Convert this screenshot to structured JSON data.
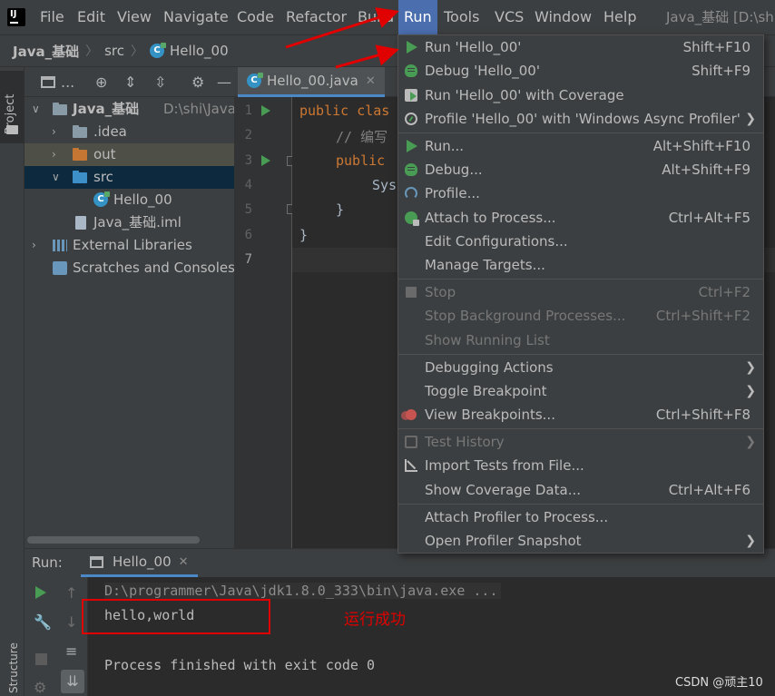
{
  "menubar": {
    "items": [
      "File",
      "Edit",
      "View",
      "Navigate",
      "Code",
      "Refactor",
      "Build",
      "Run",
      "Tools",
      "VCS",
      "Window",
      "Help"
    ],
    "active": "Run",
    "window_title": "Java_基础 [D:\\shi"
  },
  "navbar": {
    "crumbs": [
      "Java_基础",
      "src",
      "Hello_00"
    ]
  },
  "left_stripe": {
    "project_label": "Project",
    "structure_label": "Structure"
  },
  "project_panel": {
    "toolbar_dropdown": "...",
    "tree": [
      {
        "label": "Java_基础",
        "path": "D:\\shi\\Java\\te"
      },
      {
        "label": ".idea"
      },
      {
        "label": "out"
      },
      {
        "label": "src"
      },
      {
        "label": "Hello_00"
      },
      {
        "label": "Java_基础.iml"
      },
      {
        "label": "External Libraries"
      },
      {
        "label": "Scratches and Consoles"
      }
    ]
  },
  "editor": {
    "tab_label": "Hello_00.java",
    "line_numbers": [
      "1",
      "2",
      "3",
      "4",
      "5",
      "6",
      "7"
    ],
    "code": {
      "line1_kw": "public clas",
      "line2_comment": "// 编写",
      "line3_kw": "public",
      "line4": "Sys",
      "line5": "}",
      "line6": "}"
    }
  },
  "run_menu": {
    "items": [
      {
        "label": "Run 'Hello_00'",
        "shortcut": "Shift+F10",
        "icon": "run-icon"
      },
      {
        "label": "Debug 'Hello_00'",
        "shortcut": "Shift+F9",
        "icon": "debug-icon"
      },
      {
        "label": "Run 'Hello_00' with Coverage",
        "shortcut": "",
        "icon": "coverage-icon"
      },
      {
        "label": "Profile 'Hello_00' with 'Windows Async Profiler'",
        "shortcut": "",
        "icon": "profile-icon",
        "submenu": true
      },
      {
        "label": "Run...",
        "shortcut": "Alt+Shift+F10",
        "icon": "run-icon"
      },
      {
        "label": "Debug...",
        "shortcut": "Alt+Shift+F9",
        "icon": "debug-icon"
      },
      {
        "label": "Profile...",
        "shortcut": "",
        "icon": "gauge-icon"
      },
      {
        "label": "Attach to Process...",
        "shortcut": "Ctrl+Alt+F5",
        "icon": "attach-icon"
      },
      {
        "label": "Edit Configurations...",
        "shortcut": ""
      },
      {
        "label": "Manage Targets...",
        "shortcut": ""
      },
      {
        "label": "Stop",
        "shortcut": "Ctrl+F2",
        "icon": "stop-icon",
        "disabled": true
      },
      {
        "label": "Stop Background Processes...",
        "shortcut": "Ctrl+Shift+F2",
        "disabled": true
      },
      {
        "label": "Show Running List",
        "shortcut": "",
        "disabled": true
      },
      {
        "label": "Debugging Actions",
        "shortcut": "",
        "submenu": true
      },
      {
        "label": "Toggle Breakpoint",
        "shortcut": "",
        "submenu": true
      },
      {
        "label": "View Breakpoints...",
        "shortcut": "Ctrl+Shift+F8",
        "icon": "breakpoints-icon"
      },
      {
        "label": "Test History",
        "shortcut": "",
        "disabled": true,
        "submenu": true
      },
      {
        "label": "Import Tests from File...",
        "shortcut": "",
        "icon": "import-icon"
      },
      {
        "label": "Show Coverage Data...",
        "shortcut": "Ctrl+Alt+F6"
      },
      {
        "label": "Attach Profiler to Process...",
        "shortcut": ""
      },
      {
        "label": "Open Profiler Snapshot",
        "shortcut": "",
        "submenu": true
      }
    ]
  },
  "run_window": {
    "title": "Run:",
    "tab_label": "Hello_00",
    "console_lines": [
      "D:\\programmer\\Java\\jdk1.8.0_333\\bin\\java.exe ...",
      "hello,world",
      "",
      "Process finished with exit code 0"
    ]
  },
  "annotation": {
    "success_text": "运行成功",
    "highlight_color": "#e00000"
  },
  "watermark": "CSDN @顽主10",
  "colors": {
    "accent": "#4b6eaf",
    "run_green": "#499c54",
    "keyword": "#cc7832"
  }
}
